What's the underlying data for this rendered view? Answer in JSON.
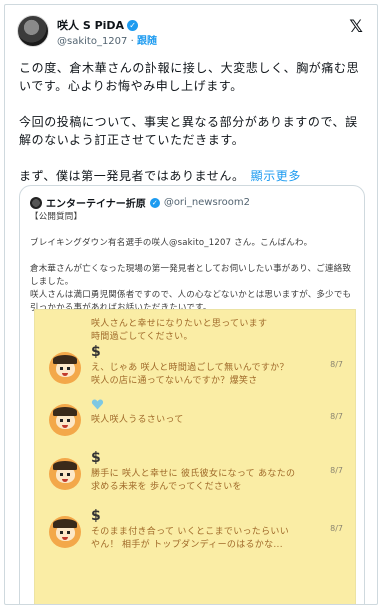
{
  "author": {
    "name": "咲人 S PiDA",
    "handle": "@sakito_1207",
    "separator": "·",
    "follow_label": "跟随"
  },
  "x_logo": "𝕏",
  "post": {
    "paragraph1": "この度、倉木華さんの訃報に接し、大変悲しく、胸が痛む思いです。心よりお悔やみ申し上げます。",
    "paragraph2": "今回の投稿について、事実と異なる部分がありますので、誤解のないよう訂正させていただきます。",
    "paragraph3": "まず、僕は第一発見者ではありません。",
    "show_more": "顯示更多"
  },
  "quote": {
    "name": "エンターテイナー折原",
    "handle": "@ori_newsroom2",
    "line1": "【公開質問】",
    "line2": "ブレイキングダウン有名選手の咲人@sakito_1207 さん。こんばんわ。",
    "line3": "倉木華さんが亡くなった現場の第一発見者としてお伺いしたい事があり、ご連絡致しました。",
    "line4": "咲人さんは満口勇児関係者ですので、人の心などないかとは思いますが、多少でも引っかかる事があればお話いただきたいです。"
  },
  "chat": {
    "messages": [
      {
        "icon": "",
        "text_lines": [
          "咲人さんと幸せになりたいと思っています",
          "時間過ごしてください。"
        ],
        "time": ""
      },
      {
        "icon": "$",
        "text_lines": [
          "え、じゃあ 咲人と時間過ごして無いんですか？",
          "咲人の店に通ってないんですか？爆笑さ"
        ],
        "time": "8/7"
      },
      {
        "icon": "heart",
        "text_lines": [
          "咲人咲人うるさいって"
        ],
        "time": "8/7"
      },
      {
        "icon": "$",
        "text_lines": [
          "勝手に 咲人と幸せに 彼氏彼女になって あなたの",
          "求める未来を 歩んでってくださいを"
        ],
        "time": "8/7"
      },
      {
        "icon": "$",
        "text_lines": [
          "そのまま付き合って いくとこまでいったらいい",
          "やん！ 相手が トップダンディーのはるかな..."
        ],
        "time": "8/7"
      }
    ]
  },
  "colors": {
    "accent": "#1d9bf0",
    "chat_bg": "#faeda5",
    "chat_text": "#a06a2a",
    "heart": "#7ec8e3"
  }
}
